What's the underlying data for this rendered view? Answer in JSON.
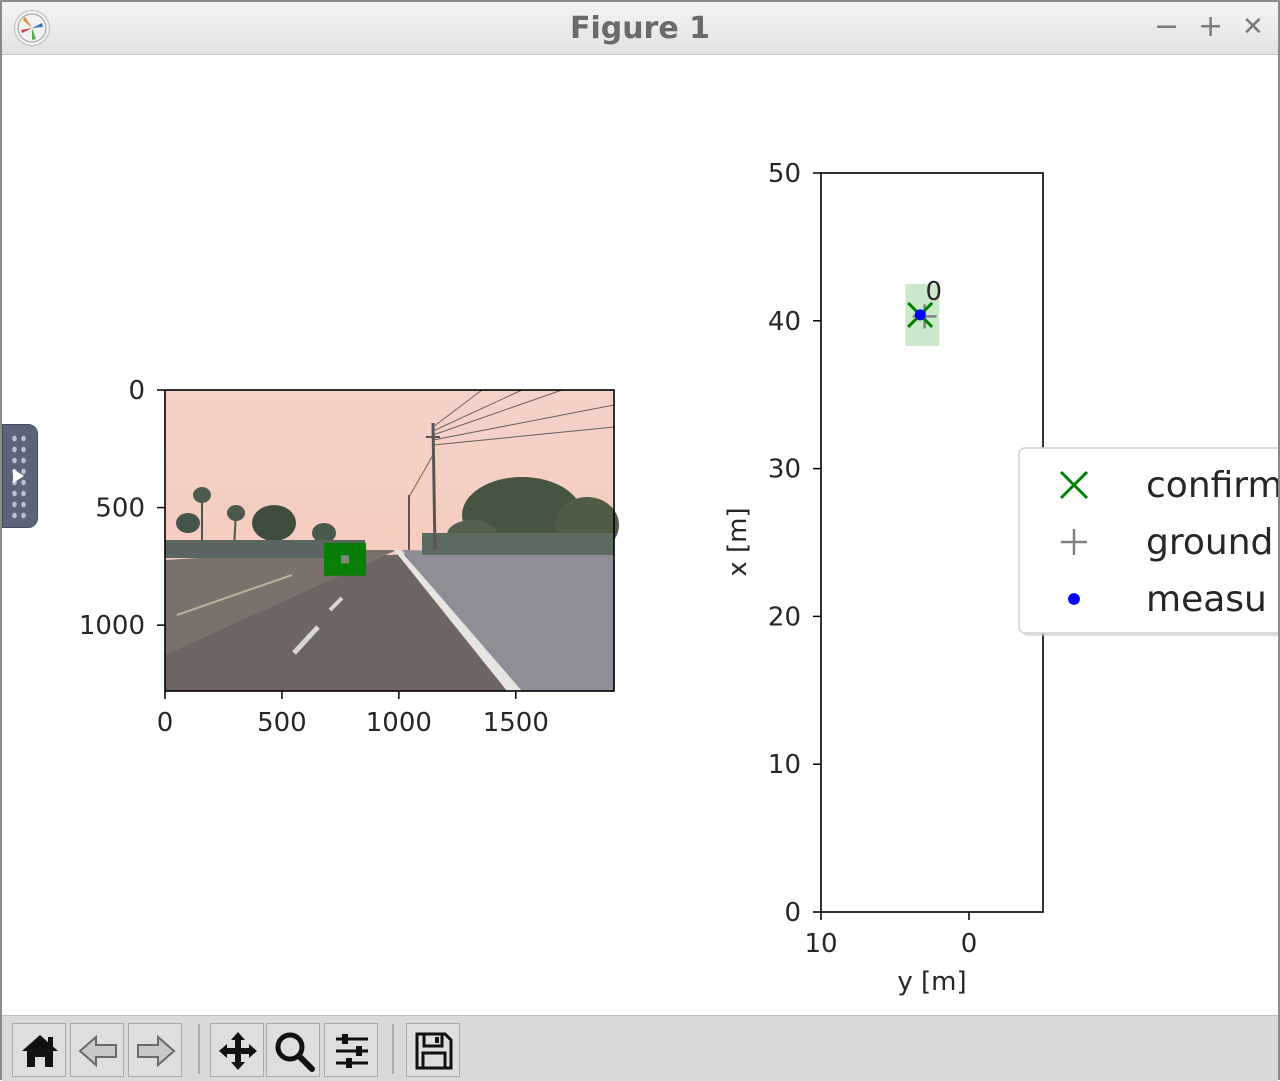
{
  "window": {
    "title": "Figure 1",
    "controls": {
      "minimize": "−",
      "maximize": "+",
      "close": "✕"
    }
  },
  "camera_axes": {
    "x_ticks": [
      {
        "value": 0,
        "label": "0"
      },
      {
        "value": 500,
        "label": "500"
      },
      {
        "value": 1000,
        "label": "1000"
      },
      {
        "value": 1500,
        "label": "1500"
      }
    ],
    "y_ticks": [
      {
        "value": 0,
        "label": "0"
      },
      {
        "value": 500,
        "label": "500"
      },
      {
        "value": 1000,
        "label": "1000"
      }
    ],
    "image_extent": {
      "width": 1920,
      "height": 1280
    },
    "detection_box": {
      "x_min": 680,
      "x_max": 860,
      "y_min": 650,
      "y_max": 790,
      "color": "#008000"
    }
  },
  "chart_data": {
    "type": "scatter",
    "title": "",
    "xlabel": "y [m]",
    "ylabel": "x [m]",
    "xlim": [
      10,
      -5
    ],
    "ylim": [
      0,
      50
    ],
    "x_ticks": [
      {
        "value": 10,
        "label": "10"
      },
      {
        "value": 0,
        "label": "0"
      }
    ],
    "y_ticks": [
      {
        "value": 0,
        "label": "0"
      },
      {
        "value": 10,
        "label": "10"
      },
      {
        "value": 20,
        "label": "20"
      },
      {
        "value": 30,
        "label": "30"
      },
      {
        "value": 40,
        "label": "40"
      },
      {
        "value": 50,
        "label": "50"
      }
    ],
    "series": [
      {
        "marker": "x",
        "color": "#008000",
        "points": [
          {
            "y": 3.3,
            "x": 40.4
          }
        ]
      },
      {
        "marker": "+",
        "color": "#808080",
        "points": [
          {
            "y": 3.0,
            "x": 40.3
          }
        ]
      },
      {
        "marker": "dot",
        "color": "#0000ff",
        "points": [
          {
            "y": 3.3,
            "x": 40.4
          }
        ]
      }
    ],
    "track_label": {
      "text": "0",
      "y": 2.8,
      "x": 41.8
    },
    "uncertainty_box": {
      "y_min": 2.0,
      "y_max": 4.3,
      "x_min": 38.3,
      "x_max": 42.5,
      "color": "#a8d8a8"
    },
    "legend": {
      "placement": "right",
      "entries": [
        {
          "marker": "x",
          "color": "#008000",
          "label": "confirm"
        },
        {
          "marker": "+",
          "color": "#808080",
          "label": "ground"
        },
        {
          "marker": "dot",
          "color": "#0000ff",
          "label": "measu"
        }
      ]
    },
    "grid": false
  },
  "toolbar": {
    "buttons": [
      {
        "icon": "home-icon",
        "name": "home-button"
      },
      {
        "icon": "back-arrow-icon",
        "name": "back-button"
      },
      {
        "icon": "forward-arrow-icon",
        "name": "forward-button"
      },
      {
        "icon": "pan-icon",
        "name": "pan-button"
      },
      {
        "icon": "zoom-icon",
        "name": "zoom-button"
      },
      {
        "icon": "configure-subplots-icon",
        "name": "subplots-button"
      },
      {
        "icon": "save-icon",
        "name": "save-button"
      }
    ]
  }
}
